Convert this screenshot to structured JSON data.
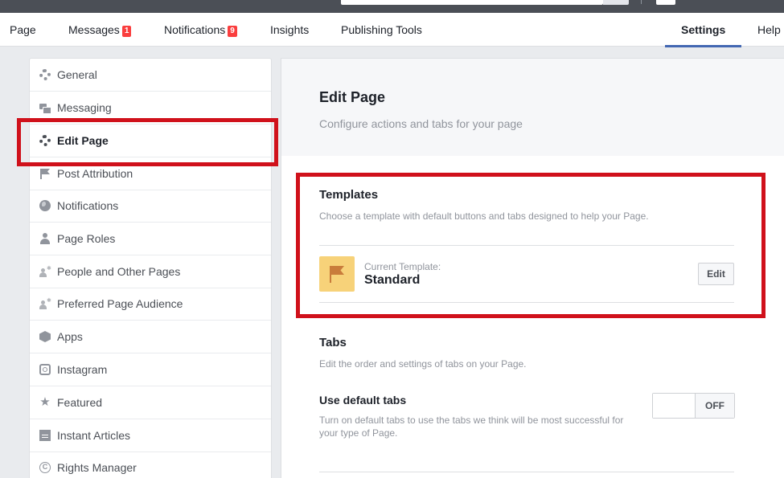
{
  "colors": {
    "accent": "#4267b2",
    "badge": "#fa3e3e",
    "highlight": "#d0111b",
    "template_icon_bg": "#f7d279"
  },
  "nav": {
    "items": [
      {
        "label": "Page"
      },
      {
        "label": "Messages",
        "badge": "1"
      },
      {
        "label": "Notifications",
        "badge": "9"
      },
      {
        "label": "Insights"
      },
      {
        "label": "Publishing Tools"
      },
      {
        "label": "Settings",
        "active": true
      },
      {
        "label": "Help"
      }
    ]
  },
  "sidebar": {
    "items": [
      {
        "label": "General",
        "icon": "gear-icon"
      },
      {
        "label": "Messaging",
        "icon": "messaging-icon"
      },
      {
        "label": "Edit Page",
        "icon": "gear-icon",
        "active": true
      },
      {
        "label": "Post Attribution",
        "icon": "flag-icon"
      },
      {
        "label": "Notifications",
        "icon": "globe-icon"
      },
      {
        "label": "Page Roles",
        "icon": "person-icon"
      },
      {
        "label": "People and Other Pages",
        "icon": "person-star-icon"
      },
      {
        "label": "Preferred Page Audience",
        "icon": "person-star-icon"
      },
      {
        "label": "Apps",
        "icon": "cube-icon"
      },
      {
        "label": "Instagram",
        "icon": "instagram-icon"
      },
      {
        "label": "Featured",
        "icon": "star-icon"
      },
      {
        "label": "Instant Articles",
        "icon": "article-icon"
      },
      {
        "label": "Rights Manager",
        "icon": "copyright-icon"
      }
    ]
  },
  "main": {
    "title": "Edit Page",
    "subtitle": "Configure actions and tabs for your page",
    "templates": {
      "title": "Templates",
      "description": "Choose a template with default buttons and tabs designed to help your Page.",
      "current_label": "Current Template:",
      "current_value": "Standard",
      "edit_label": "Edit"
    },
    "tabs": {
      "title": "Tabs",
      "description": "Edit the order and settings of tabs on your Page.",
      "option_title": "Use default tabs",
      "option_description": "Turn on default tabs to use the tabs we think will be most successful for your type of Page.",
      "toggle_state": "OFF"
    }
  }
}
